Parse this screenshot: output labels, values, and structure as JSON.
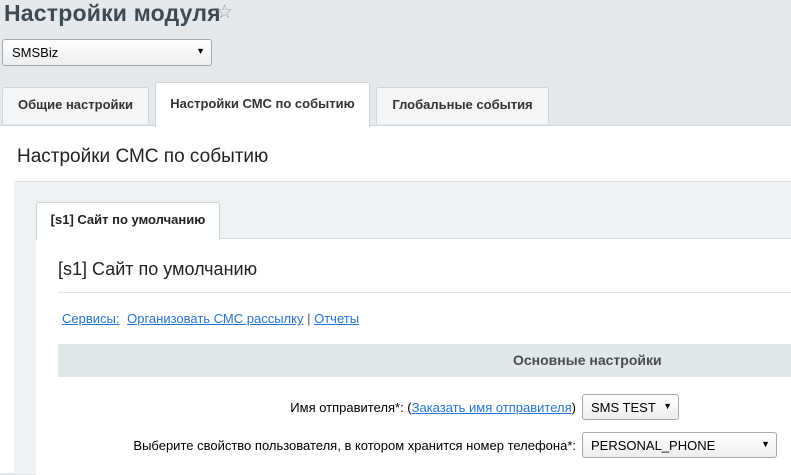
{
  "header": {
    "title": "Настройки модуля",
    "favorite_icon": "star-icon"
  },
  "module_select": {
    "value": "SMSBiz"
  },
  "tabs": [
    {
      "label": "Общие настройки",
      "active": false
    },
    {
      "label": "Настройки СМС по событию",
      "active": true
    },
    {
      "label": "Глобальные события",
      "active": false
    }
  ],
  "panel": {
    "title": "Настройки СМС по событию"
  },
  "site_tab": {
    "label": "[s1] Сайт по умолчанию",
    "title": "[s1] Сайт по умолчанию"
  },
  "links": {
    "services_label": "Сервисы:",
    "organize_sms": "Организовать СМС рассылку",
    "separator": "|",
    "reports": "Отчеты"
  },
  "section": {
    "title": "Основные настройки"
  },
  "fields": {
    "sender_label_prefix": "Имя отправителя*: (",
    "sender_link": "Заказать имя отправителя",
    "sender_label_suffix": ")",
    "sender_value": "SMS TEST",
    "phone_label": "Выберите свойство пользователя, в котором хранится номер телефона*:",
    "phone_value": "PERSONAL_PHONE"
  }
}
